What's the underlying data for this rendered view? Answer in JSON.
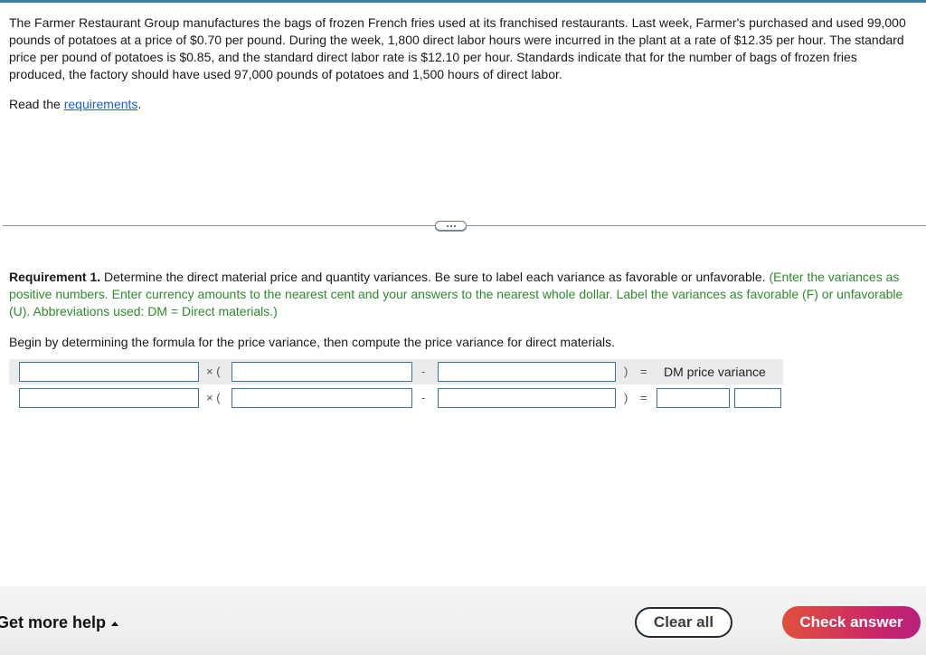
{
  "problem": {
    "text": "The Farmer Restaurant Group manufactures the bags of frozen French fries used at its franchised restaurants. Last week, Farmer's purchased and used 99,000 pounds of potatoes at a price of $0.70 per pound. During the week, 1,800 direct labor hours were incurred in the plant at a rate of $12.35 per hour. The standard price per pound of potatoes is $0.85, and the standard direct labor rate is $12.10 per hour. Standards indicate that for the number of bags of frozen fries produced, the factory should have used 97,000 pounds of potatoes and 1,500 hours of direct labor.",
    "read_prefix": "Read the ",
    "read_link": "requirements",
    "read_suffix": "."
  },
  "expander": {
    "icon": "ellipsis-icon"
  },
  "requirement": {
    "bold": "Requirement 1.",
    "text": " Determine the direct material price and quantity variances. Be sure to label each variance as favorable or unfavorable. ",
    "hint": "(Enter the variances as positive numbers. Enter currency amounts to the nearest cent and your answers to the nearest whole dollar. Label the variances as favorable (F) or unfavorable (U). Abbreviations used: DM = Direct materials.)",
    "begin": "Begin by determining the formula for the price variance, then compute the price variance for direct materials."
  },
  "formula": {
    "times_open": "× (",
    "minus": "-",
    "close_equals": ")",
    "equals": "=",
    "result_label": "DM price variance",
    "row1": {
      "a": "",
      "b": "",
      "c": ""
    },
    "row2": {
      "a": "",
      "b": "",
      "c": "",
      "amount": "",
      "label": ""
    }
  },
  "footer": {
    "help": "Get more help",
    "clear": "Clear all",
    "check": "Check answer"
  }
}
